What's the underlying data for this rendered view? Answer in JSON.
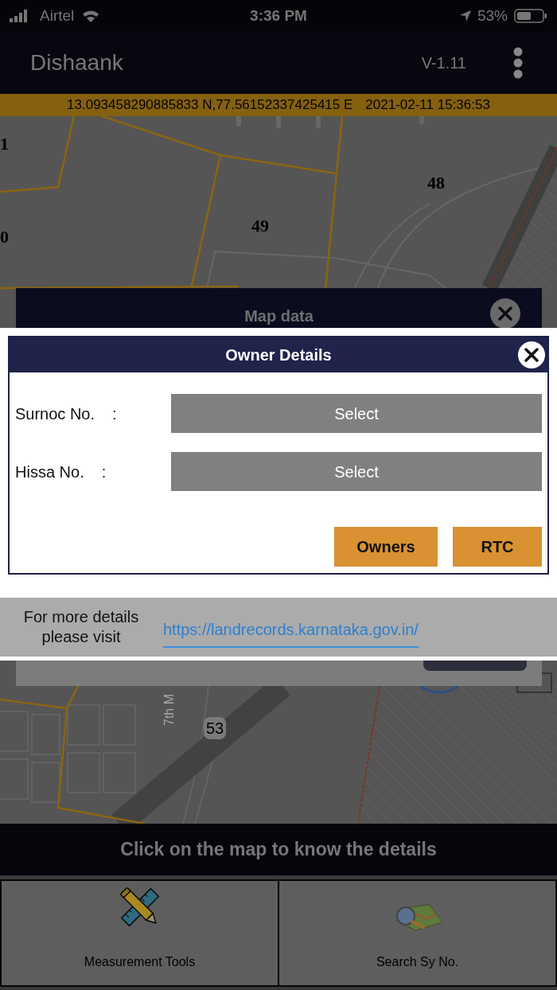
{
  "status_bar": {
    "carrier": "Airtel",
    "time": "3:36 PM",
    "battery": "53%"
  },
  "header": {
    "title": "Dishaank",
    "version": "V-1.11"
  },
  "location_bar": {
    "coordinates": "13.093458290885833 N,77.56152337425415 E",
    "timestamp": "2021-02-11 15:36:53"
  },
  "map": {
    "labels": [
      {
        "text": "1",
        "kind": "parcel"
      },
      {
        "text": "0",
        "kind": "parcel"
      },
      {
        "text": "49",
        "kind": "parcel"
      },
      {
        "text": "48",
        "kind": "parcel"
      },
      {
        "text": "7th M",
        "kind": "street"
      },
      {
        "text": "53",
        "kind": "badge"
      }
    ]
  },
  "map_data_dialog": {
    "title": "Map data"
  },
  "owner_dialog": {
    "title": "Owner Details",
    "fields": [
      {
        "label": "Surnoc No.",
        "separator": ":",
        "value": "Select"
      },
      {
        "label": "Hissa No.",
        "separator": ":",
        "value": "Select"
      }
    ],
    "buttons": [
      "Owners",
      "RTC"
    ]
  },
  "more_details": {
    "text": "For more details please visit",
    "link": "https://landrecords.karnataka.gov.in/"
  },
  "hint_bar": {
    "text": "Click on the map to know the details"
  },
  "bottom_tabs": [
    {
      "label": "Measurement Tools"
    },
    {
      "label": "Search Sy No."
    }
  ]
}
